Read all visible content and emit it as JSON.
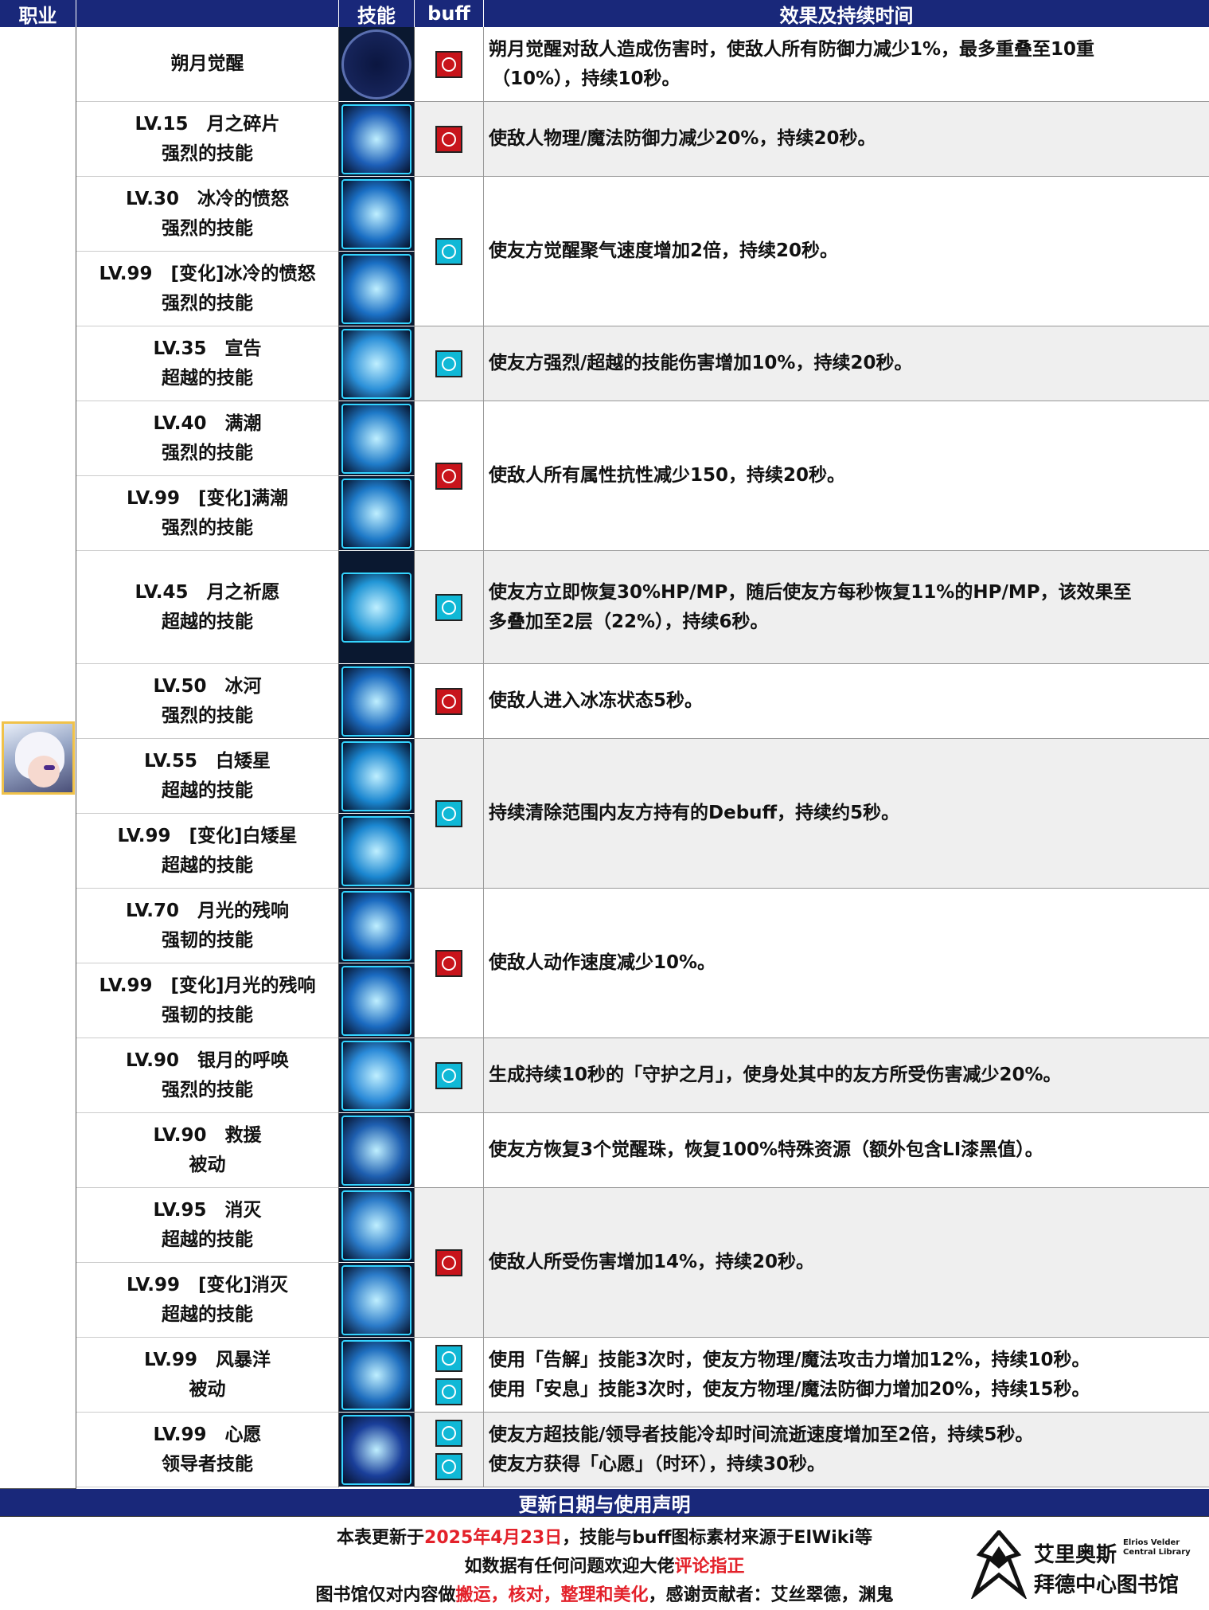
{
  "header": {
    "job": "职业",
    "skill": "技能",
    "buff": "buff",
    "effect": "效果及持续时间"
  },
  "rows": [
    {
      "name": [
        "朔月觉醒"
      ],
      "effect": [
        "朔月觉醒对敌人造成伤害时，使敌人所有防御力减少1%，最多重叠至10重",
        "（10%），持续10秒。"
      ]
    },
    {
      "name": [
        "LV.15　月之碎片",
        "强烈的技能"
      ],
      "effect": [
        "使敌人物理/魔法防御力减少20%，持续20秒。"
      ]
    },
    {
      "name": [
        "LV.30　冰冷的愤怒",
        "强烈的技能"
      ]
    },
    {
      "name": [
        "LV.99　[变化]冰冷的愤怒",
        "强烈的技能"
      ],
      "effect": [
        "使友方觉醒聚气速度增加2倍，持续20秒。"
      ]
    },
    {
      "name": [
        "LV.35　宣告",
        "超越的技能"
      ],
      "effect": [
        "使友方强烈/超越的技能伤害增加10%，持续20秒。"
      ]
    },
    {
      "name": [
        "LV.40　满潮",
        "强烈的技能"
      ]
    },
    {
      "name": [
        "LV.99　[变化]满潮",
        "强烈的技能"
      ],
      "effect": [
        "使敌人所有属性抗性减少150，持续20秒。"
      ]
    },
    {
      "name": [
        "LV.45　月之祈愿",
        "超越的技能"
      ],
      "effect": [
        "使友方立即恢复30%HP/MP，随后使友方每秒恢复11%的HP/MP，该效果至",
        "多叠加至2层（22%），持续6秒。"
      ]
    },
    {
      "name": [
        "LV.50　冰河",
        "强烈的技能"
      ],
      "effect": [
        "使敌人进入冰冻状态5秒。"
      ]
    },
    {
      "name": [
        "LV.55　白矮星",
        "超越的技能"
      ]
    },
    {
      "name": [
        "LV.99　[变化]白矮星",
        "超越的技能"
      ],
      "effect": [
        "持续清除范围内友方持有的Debuff，持续约5秒。"
      ]
    },
    {
      "name": [
        "LV.70　月光的残响",
        "强韧的技能"
      ]
    },
    {
      "name": [
        "LV.99　[变化]月光的残响",
        "强韧的技能"
      ],
      "effect": [
        "使敌人动作速度减少10%。"
      ]
    },
    {
      "name": [
        "LV.90　银月的呼唤",
        "强烈的技能"
      ],
      "effect": [
        "生成持续10秒的「守护之月」，使身处其中的友方所受伤害减少20%。"
      ]
    },
    {
      "name": [
        "LV.90　救援",
        "被动"
      ],
      "effect": [
        "使友方恢复3个觉醒珠，恢复100%特殊资源（额外包含LI漆黑值）。"
      ]
    },
    {
      "name": [
        "LV.95　消灭",
        "超越的技能"
      ]
    },
    {
      "name": [
        "LV.99　[变化]消灭",
        "超越的技能"
      ],
      "effect": [
        "使敌人所受伤害增加14%，持续20秒。"
      ]
    },
    {
      "name": [
        "LV.99　风暴洋",
        "被动"
      ],
      "effect": [
        "使用「告解」技能3次时，使友方物理/魔法攻击力增加12%，持续10秒。",
        "使用「安息」技能3次时，使友方物理/魔法防御力增加20%，持续15秒。"
      ]
    },
    {
      "name": [
        "LV.99　心愿",
        "领导者技能"
      ],
      "effect": [
        "使友方超技能/领导者技能冷却时间流逝速度增加至2倍，持续5秒。",
        "使友方获得「心愿」（时环），持续30秒。"
      ]
    }
  ],
  "footer": {
    "title": "更新日期与使用声明",
    "line1_a": "本表更新于",
    "line1_date": "2025年4月23日",
    "line1_b": "，技能与buff图标素材来源于ElWiki等",
    "line2_a": "如数据有任何问题欢迎大佬",
    "line2_red": "评论指正",
    "line3_a": "图书馆仅对内容做",
    "line3_red": "搬运，核对，整理和美化",
    "line3_b": "，感谢贡献者：艾丝翠德，渊鬼",
    "logo_cn": "艾里奥斯",
    "logo_en1": "Elrios Velder",
    "logo_en2": "Central Library",
    "logo_cn2": "拜德中心图书馆"
  },
  "colors": {
    "header_bg": "#19287a",
    "debuff_red": "#c8141b",
    "buff_cyan": "#10b8d6",
    "highlight_red": "#e3212a",
    "row_gray": "#efefef"
  }
}
